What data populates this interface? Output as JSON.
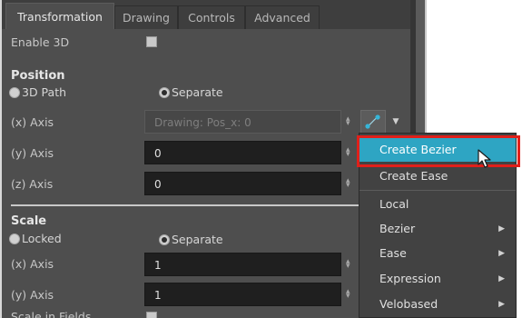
{
  "tabs": [
    "Transformation",
    "Drawing",
    "Controls",
    "Advanced"
  ],
  "enable_3d": {
    "label": "Enable 3D",
    "checked": false
  },
  "position": {
    "heading": "Position",
    "mode_options": [
      "3D Path",
      "Separate"
    ],
    "selected_mode": "Separate",
    "x_axis": {
      "label": "(x) Axis",
      "value": "Drawing: Pos_x: 0"
    },
    "y_axis": {
      "label": "(y) Axis",
      "value": "0"
    },
    "z_axis": {
      "label": "(z) Axis",
      "value": "0"
    }
  },
  "scale": {
    "heading": "Scale",
    "mode_options": [
      "Locked",
      "Separate"
    ],
    "selected_mode": "Separate",
    "x_axis": {
      "label": "(x) Axis",
      "value": "1"
    },
    "y_axis": {
      "label": "(y) Axis",
      "value": "1"
    },
    "scale_in_fields_label": "Scale in Fields"
  },
  "function_menu": {
    "items": [
      "Create Bezier",
      "Create Ease",
      "Local",
      "Bezier",
      "Ease",
      "Expression",
      "Velobased"
    ],
    "highlighted": "Create Bezier",
    "submenu_items": [
      "Bezier",
      "Ease",
      "Expression",
      "Velobased"
    ]
  },
  "icons": {
    "function_button": "function-curve-icon",
    "dropdown": "chevron-down-icon",
    "spinner": "spinner-arrows-icon",
    "submenu": "chevron-right-icon",
    "cursor": "mouse-pointer-icon"
  },
  "colors": {
    "highlight": "#2ea5c3",
    "callout": "#e0201a",
    "panel_bg": "#4e4e4e"
  }
}
